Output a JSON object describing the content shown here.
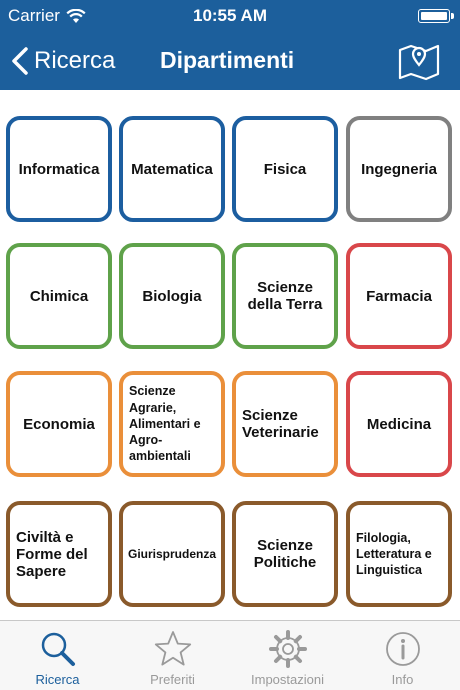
{
  "status_bar": {
    "carrier": "Carrier",
    "time": "10:55 AM"
  },
  "nav": {
    "back_label": "Ricerca",
    "title": "Dipartimenti",
    "map_icon": "map-location-icon"
  },
  "colors": {
    "blue": "#1c5ea0",
    "gray": "#808080",
    "green": "#5fa24a",
    "red": "#d9474a",
    "orange": "#ea8f3a",
    "brown": "#8a5a2b",
    "accent": "#1c5f9c"
  },
  "departments": [
    {
      "label": "Informatica",
      "color": "#1c5ea0"
    },
    {
      "label": "Matematica",
      "color": "#1c5ea0"
    },
    {
      "label": "Fisica",
      "color": "#1c5ea0"
    },
    {
      "label": "Ingegneria",
      "color": "#808080"
    },
    {
      "label": "Chimica",
      "color": "#5fa24a"
    },
    {
      "label": "Biologia",
      "color": "#5fa24a"
    },
    {
      "label": "Scienze della Terra",
      "color": "#5fa24a"
    },
    {
      "label": "Farmacia",
      "color": "#d9474a"
    },
    {
      "label": "Economia",
      "color": "#ea8f3a"
    },
    {
      "label": "Scienze Agrarie, Alimentari e Agro-ambientali",
      "color": "#ea8f3a"
    },
    {
      "label": "Scienze Veterinarie",
      "color": "#ea8f3a"
    },
    {
      "label": "Medicina",
      "color": "#d9474a"
    },
    {
      "label": "Civiltà e Forme del Sapere",
      "color": "#8a5a2b"
    },
    {
      "label": "Giurisprudenza",
      "color": "#8a5a2b"
    },
    {
      "label": "Scienze Politiche",
      "color": "#8a5a2b"
    },
    {
      "label": "Filologia, Letteratura e Linguistica",
      "color": "#8a5a2b"
    }
  ],
  "tabs": [
    {
      "label": "Ricerca",
      "icon": "search-icon",
      "active": true
    },
    {
      "label": "Preferiti",
      "icon": "star-icon",
      "active": false
    },
    {
      "label": "Impostazioni",
      "icon": "gear-icon",
      "active": false
    },
    {
      "label": "Info",
      "icon": "info-icon",
      "active": false
    }
  ]
}
